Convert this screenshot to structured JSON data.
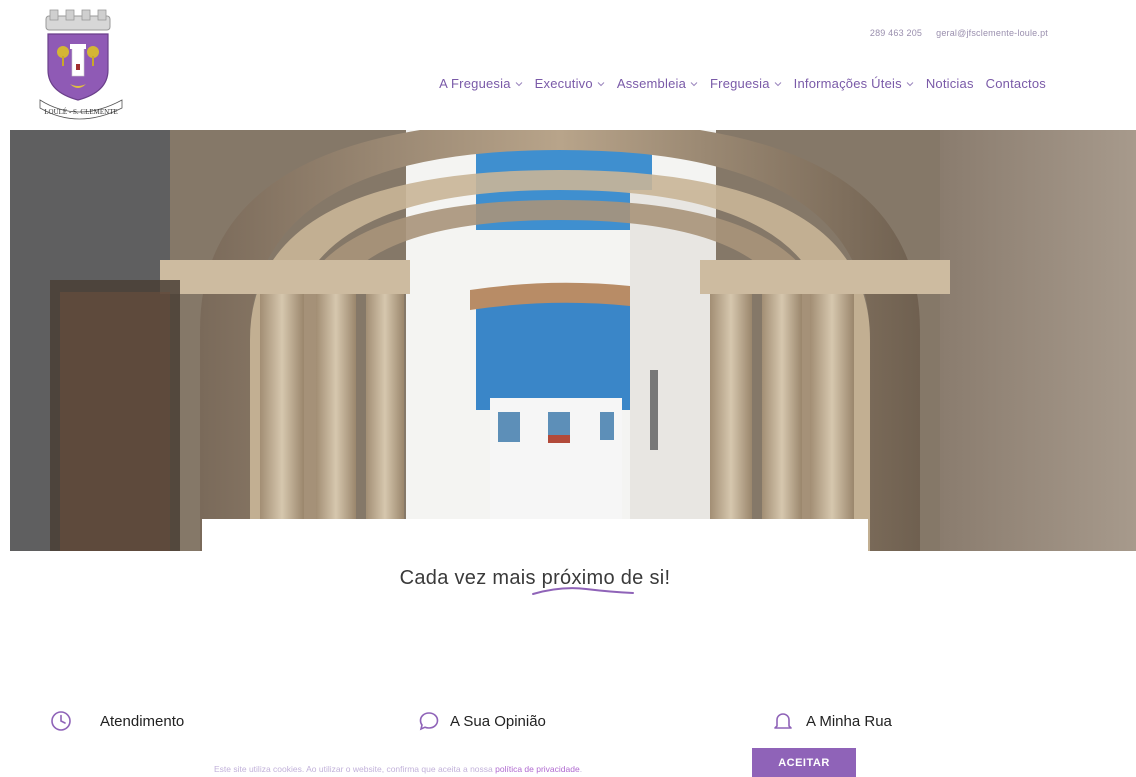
{
  "header": {
    "phone": "289 463 205",
    "email": "geral@jfsclemente-loule.pt",
    "logo_text": "LOULÉ - S. CLEMENTE"
  },
  "nav": {
    "items": [
      {
        "label": "A Freguesia",
        "dropdown": true
      },
      {
        "label": "Executivo",
        "dropdown": true
      },
      {
        "label": "Assembleia",
        "dropdown": true
      },
      {
        "label": "Freguesia",
        "dropdown": true
      },
      {
        "label": "Informações Úteis",
        "dropdown": true
      },
      {
        "label": "Noticias",
        "dropdown": false
      },
      {
        "label": "Contactos",
        "dropdown": false
      }
    ]
  },
  "tagline": {
    "before": "Cada vez mais ",
    "accent": "próximo",
    "after": " de si!"
  },
  "features": [
    {
      "label": "Atendimento",
      "icon": "clock-icon"
    },
    {
      "label": "A Sua Opinião",
      "icon": "speech-bubble-icon"
    },
    {
      "label": "A Minha Rua",
      "icon": "bell-icon"
    }
  ],
  "cookie": {
    "text": "Este site utiliza cookies. Ao utilizar o website, confirma que aceita a nossa ",
    "link": "política de privacidade",
    "end": ".",
    "accept_label": "ACEITAR"
  },
  "colors": {
    "accent": "#8f63b8",
    "nav_text": "#7a5aa8",
    "sky": "#3f8fcf"
  }
}
